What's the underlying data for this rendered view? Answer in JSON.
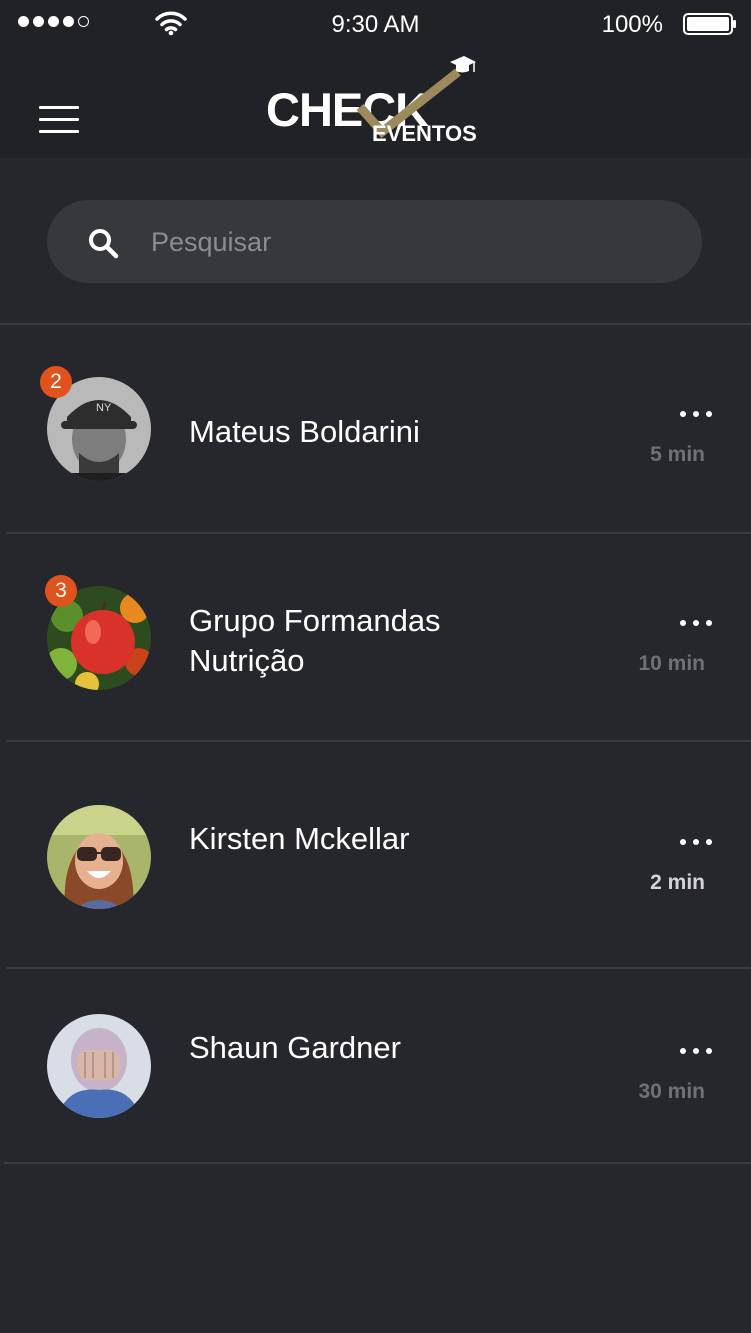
{
  "status_bar": {
    "time": "9:30 AM",
    "battery": "100%"
  },
  "header": {
    "logo_main": "CHECK",
    "logo_sub": "EVENTOS",
    "icons": {
      "menu": "hamburger-menu-icon",
      "cap": "graduation-cap-icon"
    },
    "colors": {
      "logo_check_mark": "#9c8a5c"
    }
  },
  "search": {
    "placeholder": "Pesquisar",
    "value": ""
  },
  "conversations": [
    {
      "name": "Mateus Boldarini",
      "time": "5 min",
      "badge": "2"
    },
    {
      "name": "Grupo Formandas Nutrição",
      "time": "10 min",
      "badge": "3"
    },
    {
      "name": "Kirsten Mckellar",
      "time": "2 min",
      "badge": ""
    },
    {
      "name": "Shaun Gardner",
      "time": "30 min",
      "badge": ""
    }
  ],
  "colors": {
    "background": "#26272d",
    "header": "#212227",
    "search": "#37383e",
    "badge": "#e0531f",
    "muted_text": "#707177"
  }
}
